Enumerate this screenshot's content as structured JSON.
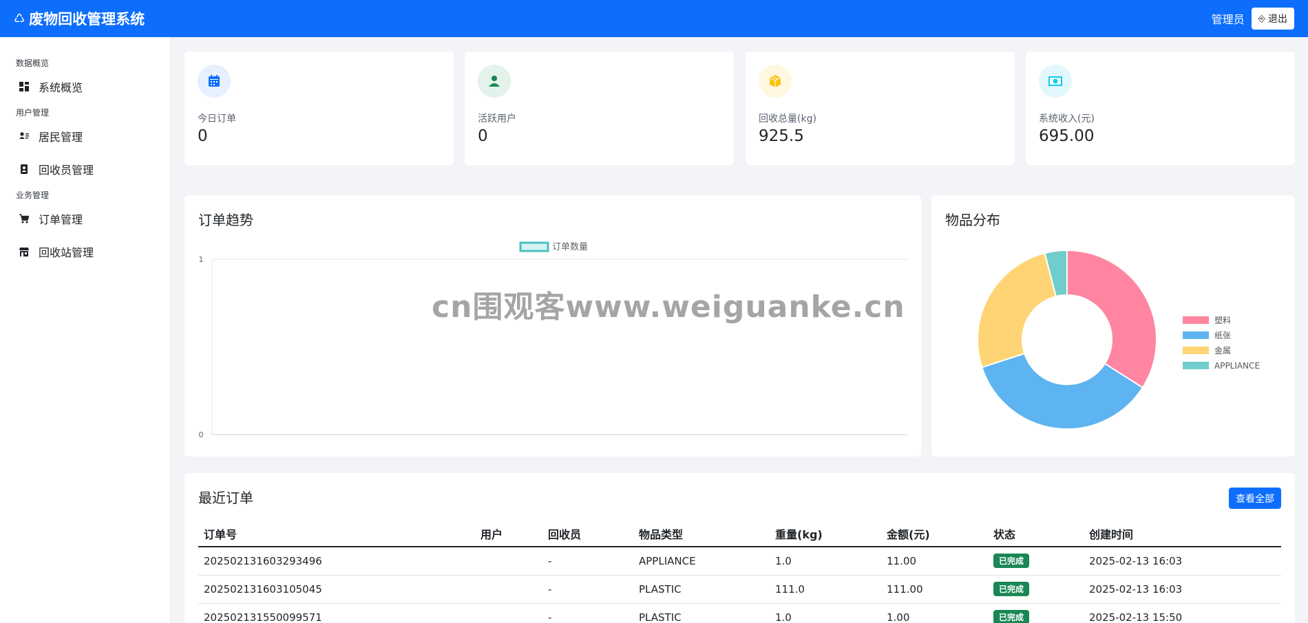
{
  "navbar": {
    "icon": "recycle-icon",
    "title": "废物回收管理系统",
    "user_label": "管理员",
    "logout_label": "退出"
  },
  "sidebar": {
    "sections": [
      {
        "title": "数据概览",
        "items": [
          {
            "label": "系统概览",
            "icon": "dashboard-icon"
          }
        ]
      },
      {
        "title": "用户管理",
        "items": [
          {
            "label": "居民管理",
            "icon": "person-card-icon"
          },
          {
            "label": "回收员管理",
            "icon": "badge-icon"
          }
        ]
      },
      {
        "title": "业务管理",
        "items": [
          {
            "label": "订单管理",
            "icon": "cart-icon"
          },
          {
            "label": "回收站管理",
            "icon": "shop-icon"
          }
        ]
      }
    ]
  },
  "stats": [
    {
      "label": "今日订单",
      "value": "0",
      "icon": "calendar-icon",
      "bg": "#e7f0ff",
      "fg": "#0d6efd"
    },
    {
      "label": "活跃用户",
      "value": "0",
      "icon": "person-icon",
      "bg": "#e3f2ea",
      "fg": "#198754"
    },
    {
      "label": "回收总量(kg)",
      "value": "925.5",
      "icon": "box-icon",
      "bg": "#fff7e0",
      "fg": "#ffc107"
    },
    {
      "label": "系统收入(元)",
      "value": "695.00",
      "icon": "cash-icon",
      "bg": "#e1f7fb",
      "fg": "#0dcaf0"
    }
  ],
  "trend": {
    "title": "订单趋势",
    "chart_data": {
      "type": "line",
      "series": [
        {
          "name": "订单数量",
          "values": []
        }
      ],
      "ylim": [
        0,
        1
      ],
      "yticks": [
        "1",
        "0"
      ],
      "legend": "top"
    }
  },
  "distribution": {
    "title": "物品分布",
    "chart_data": {
      "type": "pie",
      "labels": [
        "塑料",
        "纸张",
        "金属",
        "APPLIANCE"
      ],
      "values": [
        34,
        36,
        26,
        4
      ],
      "colors": [
        "#ff85a1",
        "#5db4f0",
        "#ffd474",
        "#70cdcb"
      ],
      "legend": "right"
    }
  },
  "orders": {
    "title": "最近订单",
    "view_all_label": "查看全部",
    "columns": [
      "订单号",
      "用户",
      "回收员",
      "物品类型",
      "重量(kg)",
      "金额(元)",
      "状态",
      "创建时间"
    ],
    "rows": [
      [
        "202502131603293496",
        "",
        "-",
        "APPLIANCE",
        "1.0",
        "11.00",
        "已完成",
        "2025-02-13 16:03"
      ],
      [
        "202502131603105045",
        "",
        "-",
        "PLASTIC",
        "111.0",
        "111.00",
        "已完成",
        "2025-02-13 16:03"
      ],
      [
        "202502131550099571",
        "",
        "-",
        "PLASTIC",
        "1.0",
        "1.00",
        "已完成",
        "2025-02-13 15:50"
      ]
    ]
  },
  "watermark": "cn围观客www.weiguanke.cn"
}
